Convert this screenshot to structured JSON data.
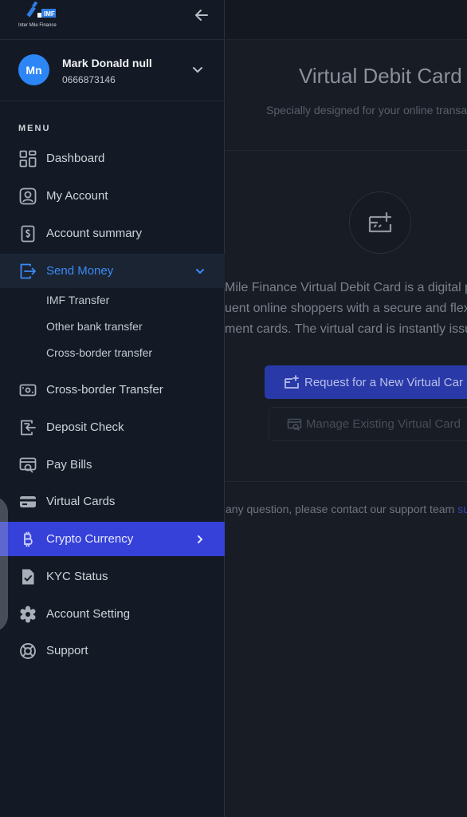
{
  "app": {
    "logo_badge": "IMF",
    "logo_caption": "Inter Mile Finance"
  },
  "user": {
    "initials": "Mn",
    "name": "Mark Donald null",
    "phone": "0666873146"
  },
  "menu_label": "MENU",
  "nav": {
    "dashboard": "Dashboard",
    "my_account": "My Account",
    "account_summary": "Account summary",
    "send_money": "Send Money",
    "send_money_sub": [
      "IMF Transfer",
      "Other bank transfer",
      "Cross-border transfer"
    ],
    "cross_border": "Cross-border Transfer",
    "deposit_check": "Deposit Check",
    "pay_bills": "Pay Bills",
    "virtual_cards": "Virtual Cards",
    "crypto": "Crypto Currency",
    "kyc": "KYC Status",
    "account_setting": "Account Setting",
    "support": "Support"
  },
  "page": {
    "title": "Virtual Debit Card",
    "subtitle": "Specially designed for your online transac",
    "description": [
      "Mile Finance Virtual Debit Card is a digital pay",
      "uent online shoppers with a secure and flexi",
      "ment cards. The virtual card is instantly issu"
    ],
    "request_button": "Request for a New Virtual Car",
    "manage_button": "Manage Existing Virtual Card",
    "support_text": "any question, please contact our support team ",
    "support_link": "sup"
  },
  "colors": {
    "sidebar_bg": "#131a25",
    "accent_blue": "#3b8bf5",
    "active_item": "#3541d9",
    "avatar": "#2c86f6"
  }
}
